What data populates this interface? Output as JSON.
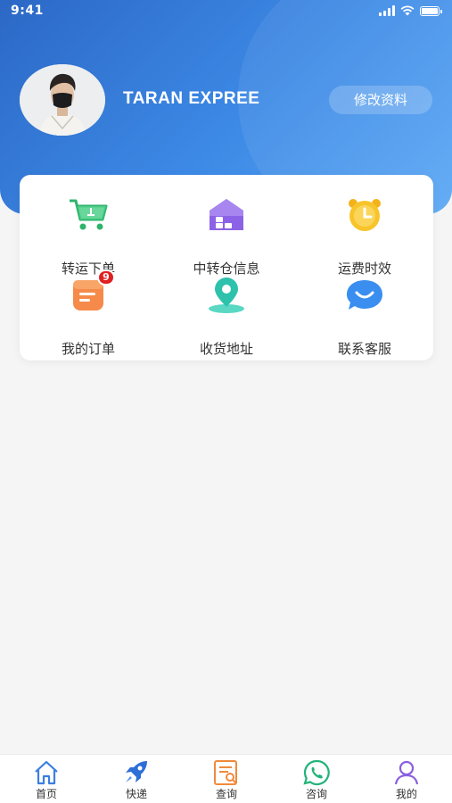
{
  "status_bar": {
    "time": "9:41"
  },
  "profile": {
    "name": "TARAN EXPREE",
    "edit_label": "修改资料"
  },
  "menu": [
    {
      "label": "转运下单",
      "icon": "shopping-cart-icon"
    },
    {
      "label": "中转仓信息",
      "icon": "warehouse-icon"
    },
    {
      "label": "运费时效",
      "icon": "alarm-clock-icon"
    },
    {
      "label": "我的订单",
      "icon": "order-clipboard-icon",
      "badge": "9"
    },
    {
      "label": "收货地址",
      "icon": "location-pin-icon"
    },
    {
      "label": "联系客服",
      "icon": "chat-bubble-icon"
    }
  ],
  "tabbar": [
    {
      "label": "首页",
      "icon": "home-icon"
    },
    {
      "label": "快递",
      "icon": "rocket-icon"
    },
    {
      "label": "查询",
      "icon": "search-document-icon"
    },
    {
      "label": "咨询",
      "icon": "whatsapp-icon"
    },
    {
      "label": "我的",
      "icon": "user-icon"
    }
  ],
  "colors": {
    "header_start": "#2c68c6",
    "header_end": "#5aa8f5",
    "badge": "#e02020",
    "cart_green": "#3fc07a",
    "tab_blue": "#3b7fe0"
  }
}
